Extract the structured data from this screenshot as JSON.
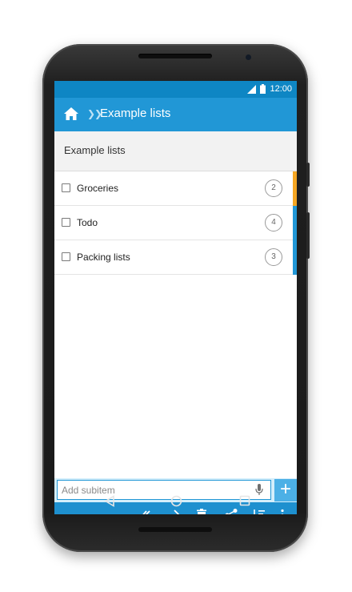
{
  "status_bar": {
    "time": "12:00"
  },
  "app_bar": {
    "separator": "❯❯",
    "title": "Example lists"
  },
  "list_header": {
    "title": "Example lists"
  },
  "items": [
    {
      "label": "Groceries",
      "count": "2",
      "tag_color": "#f5a623"
    },
    {
      "label": "Todo",
      "count": "4",
      "tag_color": "#2197d6"
    },
    {
      "label": "Packing lists",
      "count": "3",
      "tag_color": "#2197d6"
    }
  ],
  "add_bar": {
    "placeholder": "Add subitem",
    "add_label": "+"
  },
  "colors": {
    "status_bar": "#0e86c4",
    "app_bar": "#2197d6",
    "toolbar": "#1e90cf"
  },
  "toolbar_icons": [
    "done-all-icon",
    "arrow-right-icon",
    "delete-icon",
    "share-icon",
    "sort-icon",
    "more-vert-icon"
  ],
  "nav_icons": [
    "back-triangle-icon",
    "home-circle-icon",
    "recents-square-icon"
  ]
}
